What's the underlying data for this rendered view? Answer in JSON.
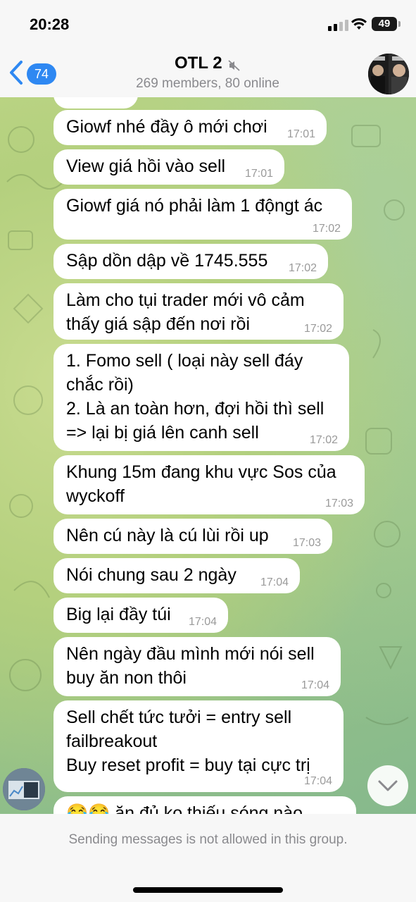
{
  "status_bar": {
    "time": "20:28",
    "battery": "49"
  },
  "header": {
    "back_count": "74",
    "title": "OTL 2",
    "subtitle": "269 members, 80 online"
  },
  "messages": [
    {
      "text": "Giowf nhé đầy ô mới chơi",
      "time": "17:01"
    },
    {
      "text": "View giá hồi vào sell",
      "time": "17:01"
    },
    {
      "text": "Giowf giá nó phải làm 1 độngt ác",
      "time": "17:02"
    },
    {
      "text": "Sập dồn dập về 1745.555",
      "time": "17:02"
    },
    {
      "text": "Làm cho tụi trader mới vô cảm\nthấy giá sập đến nơi rồi",
      "time": "17:02"
    },
    {
      "text": "1. Fomo sell ( loại này sell đáy\nchắc rồi)\n2. Là an toàn hơn, đợi hồi thì sell\n=> lại bị giá lên canh sell",
      "time": "17:02"
    },
    {
      "text": "Khung 15m đang khu vực Sos của\nwyckoff",
      "time": "17:03"
    },
    {
      "text": "Nên cú này là cú lùi rồi up",
      "time": "17:03"
    },
    {
      "text": "Nói chung sau 2 ngày",
      "time": "17:04"
    },
    {
      "text": "Big lại đầy túi",
      "time": "17:04"
    },
    {
      "text": "Nên ngày đầu mình mới nói sell\nbuy ăn non thôi",
      "time": "17:04"
    },
    {
      "text": "Sell chết tức tưởi = entry sell\nfailbreakout\nBuy reset profit = buy tại cực trị",
      "time": "17:04"
    },
    {
      "text": "😂😂 ăn đủ ko thiếu sóng nào",
      "time": ""
    }
  ],
  "footer": {
    "notice": "Sending messages is not allowed in this group."
  },
  "icons": {
    "back": "chevron-left-icon",
    "mute": "speaker-muted-icon",
    "scroll_down": "chevron-down-icon"
  },
  "colors": {
    "accent": "#2e88f2",
    "bubble": "#ffffff"
  }
}
